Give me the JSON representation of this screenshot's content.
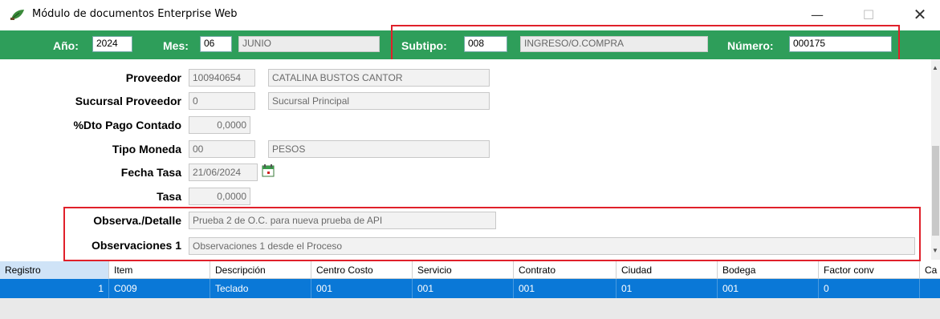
{
  "window": {
    "title": "Módulo de documentos Enterprise Web",
    "min_icon": "minimize-icon",
    "max_icon": "maximize-icon",
    "close_icon": "close-icon"
  },
  "header": {
    "anio_label": "Año:",
    "anio_value": "2024",
    "mes_label": "Mes:",
    "mes_value": "06",
    "mes_name": "JUNIO",
    "subtipo_label": "Subtipo:",
    "subtipo_value": "008",
    "subtipo_name": "INGRESO/O.COMPRA",
    "numero_label": "Número:",
    "numero_value": "000175"
  },
  "form": {
    "proveedor": {
      "label": "Proveedor",
      "code": "100940654",
      "name": "CATALINA  BUSTOS CANTOR"
    },
    "sucursal": {
      "label": "Sucursal Proveedor",
      "code": "0",
      "name": "Sucursal Principal"
    },
    "dto": {
      "label": "%Dto Pago Contado",
      "value": "0,0000"
    },
    "moneda": {
      "label": "Tipo Moneda",
      "code": "00",
      "name": "PESOS"
    },
    "fecha_tasa": {
      "label": "Fecha Tasa",
      "value": "21/06/2024",
      "icon": "calendar-icon"
    },
    "tasa": {
      "label": "Tasa",
      "value": "0,0000"
    },
    "observa": {
      "label": "Observa./Detalle",
      "value": "Prueba 2 de O.C.  para nueva prueba de API"
    },
    "observaciones1": {
      "label": "Observaciones 1",
      "value": "Observaciones 1 desde el Proceso"
    }
  },
  "grid": {
    "headers": [
      "Registro",
      "Item",
      "Descripción",
      "Centro Costo",
      "Servicio",
      "Contrato",
      "Ciudad",
      "Bodega",
      "Factor conv",
      "Ca"
    ],
    "rows": [
      [
        "1",
        "C009",
        "Teclado",
        "001",
        "001",
        "001",
        "01",
        "001",
        "0",
        ""
      ]
    ]
  },
  "colors": {
    "header_green": "#2e9e5a",
    "selected_row": "#0a78d7",
    "highlight_red": "#e0202a"
  }
}
